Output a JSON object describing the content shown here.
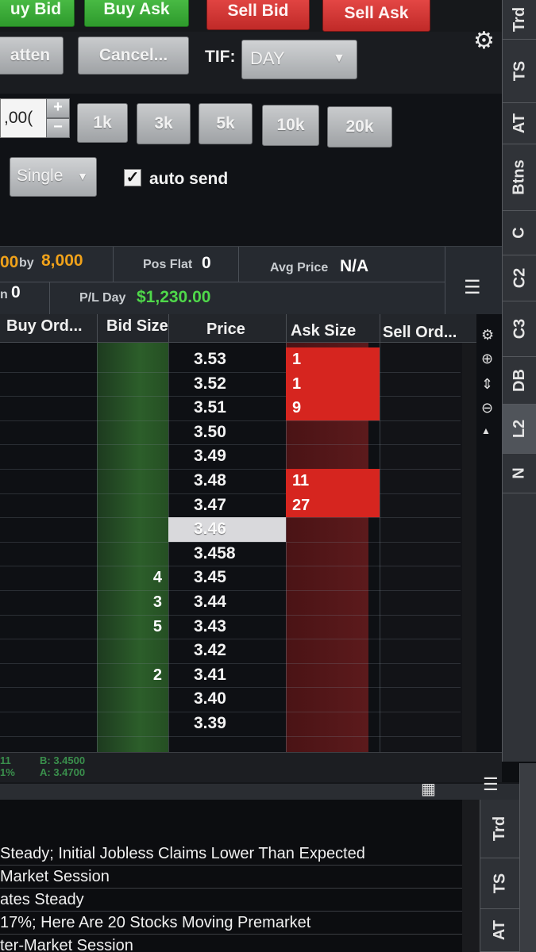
{
  "toolbar": {
    "buy_bid": "uy Bid",
    "buy_ask": "Buy Ask",
    "sell_bid": "Sell Bid",
    "sell_ask": "Sell Ask",
    "flatten": "atten",
    "cancel": "Cancel...",
    "tif_label": "TIF:",
    "tif_value": "DAY"
  },
  "quantity": {
    "value": ",00(",
    "plus": "+",
    "minus": "−",
    "presets": [
      "1k",
      "3k",
      "5k",
      "10k",
      "20k"
    ]
  },
  "order_mode": {
    "value": "Single",
    "auto_send_label": "auto send",
    "auto_send_checked": "✓"
  },
  "position": {
    "size_prefix": "00",
    "by_label": "by",
    "by_value": "8,000",
    "pos_label": "Pos Flat",
    "pos_value": "0",
    "avg_label": "Avg Price",
    "avg_value": "N/A",
    "left_label": "n",
    "left_value": "0",
    "pl_label": "P/L Day",
    "pl_value": "$1,230.00"
  },
  "ladder": {
    "columns": [
      "Buy Ord...",
      "Bid Size",
      "Price",
      "Ask Size",
      "Sell Ord..."
    ],
    "rows": [
      {
        "price": "3.53",
        "ask": "1",
        "bid": ""
      },
      {
        "price": "3.52",
        "ask": "1",
        "bid": ""
      },
      {
        "price": "3.51",
        "ask": "9",
        "bid": ""
      },
      {
        "price": "3.50",
        "ask": "",
        "bid": ""
      },
      {
        "price": "3.49",
        "ask": "",
        "bid": ""
      },
      {
        "price": "3.48",
        "ask": "11",
        "bid": ""
      },
      {
        "price": "3.47",
        "ask": "27",
        "bid": ""
      },
      {
        "price": "3.46",
        "ask": "",
        "bid": ""
      },
      {
        "price": "3.458",
        "ask": "",
        "bid": ""
      },
      {
        "price": "3.45",
        "ask": "",
        "bid": "4"
      },
      {
        "price": "3.44",
        "ask": "",
        "bid": "3"
      },
      {
        "price": "3.43",
        "ask": "",
        "bid": "5"
      },
      {
        "price": "3.42",
        "ask": "",
        "bid": ""
      },
      {
        "price": "3.41",
        "ask": "",
        "bid": "2"
      },
      {
        "price": "3.40",
        "ask": "",
        "bid": ""
      },
      {
        "price": "3.39",
        "ask": "",
        "bid": ""
      }
    ]
  },
  "quote": {
    "left_top": "11",
    "left_bottom": "1%",
    "bid": "B: 3.4500",
    "ask": "A: 3.4700"
  },
  "tabs_right": [
    "Trd",
    "TS",
    "AT",
    "Btns",
    "C",
    "C2",
    "C3",
    "DB",
    "L2",
    "N"
  ],
  "news": {
    "lines": [
      "Steady; Initial Jobless Claims Lower Than Expected",
      "Market Session",
      "ates Steady",
      "17%; Here Are 20 Stocks Moving Premarket",
      "ter-Market Session"
    ],
    "tabs": [
      "Trd",
      "TS",
      "AT"
    ]
  },
  "colors": {
    "green": "#3fb23c",
    "red": "#d6251f",
    "profit": "#4fd84a",
    "by_value": "#f0a21a"
  }
}
